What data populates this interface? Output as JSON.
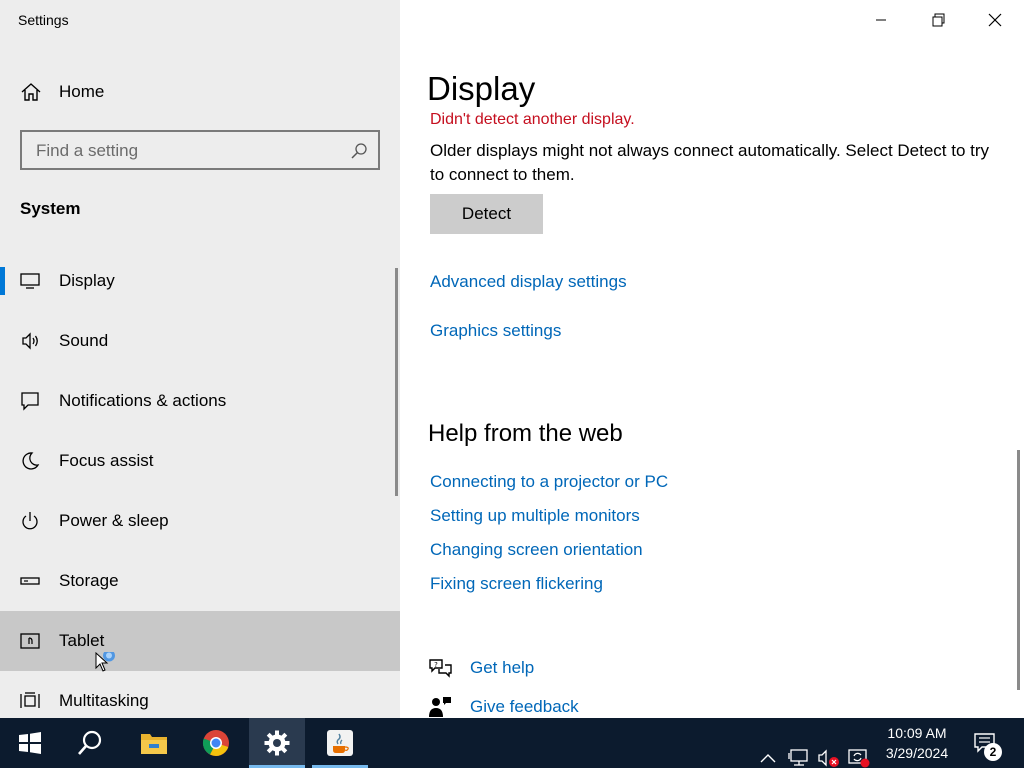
{
  "window": {
    "app_title": "Settings"
  },
  "sidebar": {
    "home_label": "Home",
    "search_placeholder": "Find a setting",
    "section_label": "System",
    "items": [
      {
        "label": "Display",
        "icon": "monitor-icon",
        "active": true
      },
      {
        "label": "Sound",
        "icon": "speaker-icon"
      },
      {
        "label": "Notifications & actions",
        "icon": "notification-icon"
      },
      {
        "label": "Focus assist",
        "icon": "moon-icon"
      },
      {
        "label": "Power & sleep",
        "icon": "power-icon"
      },
      {
        "label": "Storage",
        "icon": "storage-icon"
      },
      {
        "label": "Tablet",
        "icon": "tablet-icon",
        "hover": true
      },
      {
        "label": "Multitasking",
        "icon": "multitasking-icon"
      }
    ]
  },
  "main": {
    "page_title": "Display",
    "error_text": "Didn't detect another display.",
    "description": "Older displays might not always connect automatically. Select Detect to try to connect to them.",
    "detect_button": "Detect",
    "links": {
      "advanced": "Advanced display settings",
      "graphics": "Graphics settings"
    },
    "help": {
      "heading": "Help from the web",
      "links": [
        "Connecting to a projector or PC",
        "Setting up multiple monitors",
        "Changing screen orientation",
        "Fixing screen flickering"
      ]
    },
    "get_help": "Get help",
    "give_feedback": "Give feedback"
  },
  "taskbar": {
    "apps": [
      "start-icon",
      "search-icon",
      "file-explorer-icon",
      "chrome-icon",
      "settings-icon",
      "java-icon"
    ],
    "active_app": "settings-icon",
    "clock_time": "10:09 AM",
    "clock_date": "3/29/2024",
    "notification_count": "2"
  },
  "colors": {
    "accent": "#0078d7",
    "link": "#0067b8",
    "error": "#c50f1f",
    "sidebar_bg": "#ededed",
    "taskbar_bg": "#0c1b2e"
  }
}
